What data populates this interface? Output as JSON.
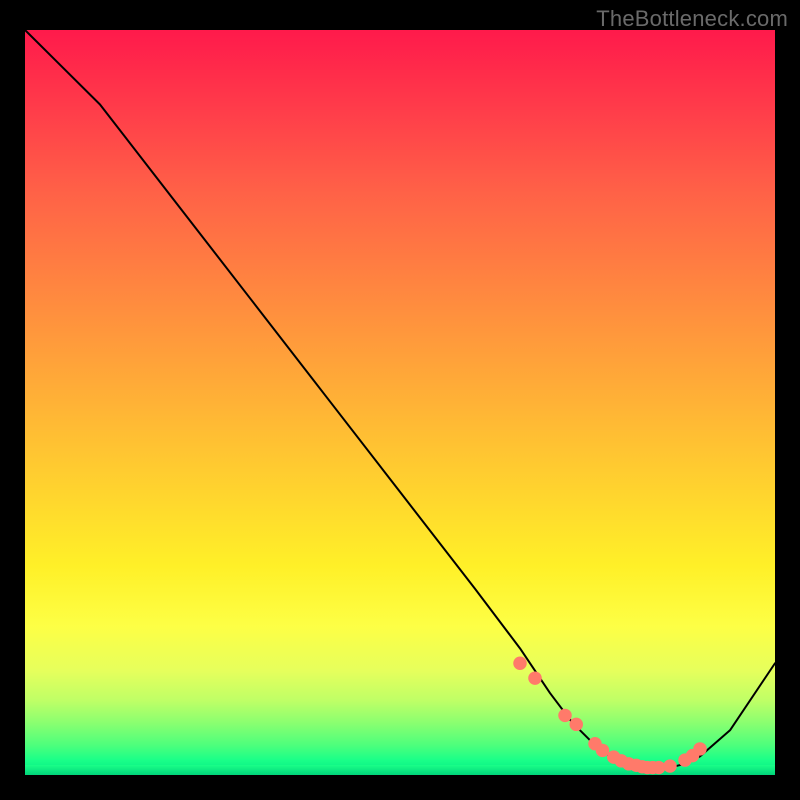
{
  "watermark": "TheBottleneck.com",
  "chart_data": {
    "type": "line",
    "title": "",
    "xlabel": "",
    "ylabel": "",
    "xlim": [
      0,
      100
    ],
    "ylim": [
      0,
      100
    ],
    "series": [
      {
        "name": "bottleneck-curve",
        "x": [
          0,
          4,
          10,
          20,
          30,
          40,
          50,
          60,
          66,
          70,
          73,
          76,
          78,
          80,
          82,
          84,
          86,
          88,
          90,
          94,
          100
        ],
        "y": [
          100,
          96,
          90,
          77,
          64,
          51,
          38,
          25,
          17,
          11,
          7,
          4,
          2.5,
          1.5,
          1,
          1,
          1,
          1.5,
          2.5,
          6,
          15
        ]
      }
    ],
    "markers": {
      "name": "highlight-dots",
      "color": "#ff7a6a",
      "points_x": [
        66,
        68,
        72,
        73.5,
        76,
        77,
        78.5,
        79.5,
        80.5,
        81.5,
        82.3,
        83,
        83.7,
        84.5,
        86,
        88,
        89,
        90
      ],
      "points_y": [
        15,
        13,
        8,
        6.8,
        4.2,
        3.3,
        2.4,
        1.9,
        1.5,
        1.3,
        1.1,
        1.0,
        1.0,
        1.0,
        1.2,
        2.0,
        2.6,
        3.5
      ]
    },
    "gradient_colors": {
      "top": "#ff1a4b",
      "middle": "#fff028",
      "bottom": "#00e884"
    }
  }
}
